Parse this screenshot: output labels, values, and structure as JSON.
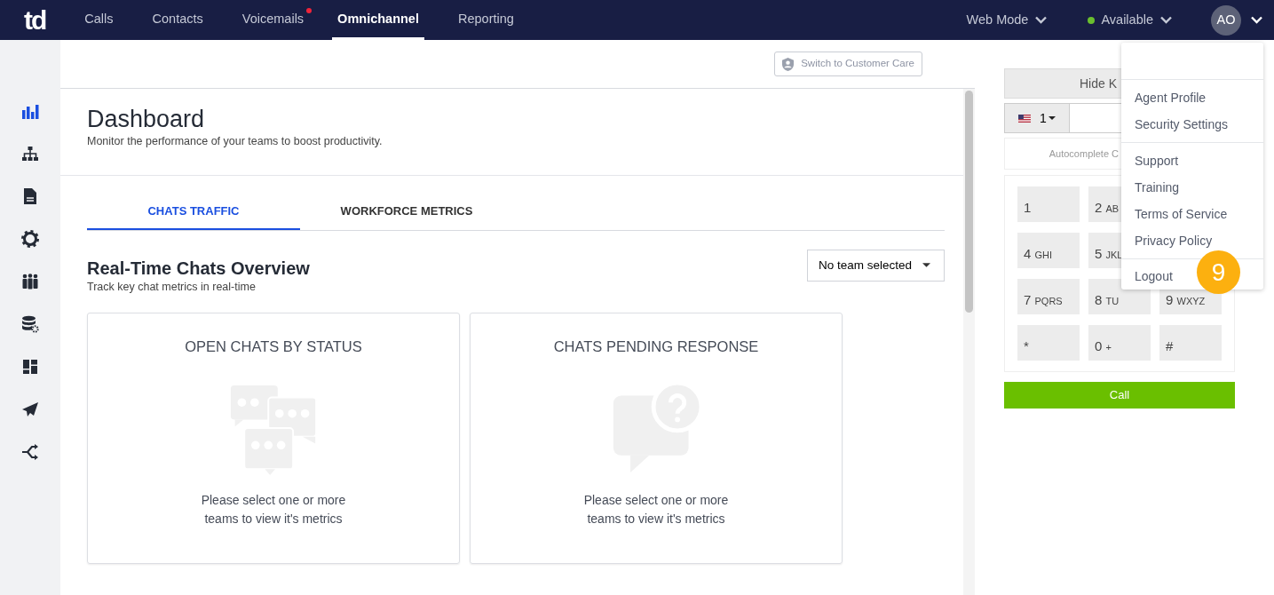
{
  "navbar": {
    "logo": "td",
    "items": [
      {
        "label": "Calls",
        "selected": false,
        "notification": false
      },
      {
        "label": "Contacts",
        "selected": false,
        "notification": false
      },
      {
        "label": "Voicemails",
        "selected": false,
        "notification": true
      },
      {
        "label": "Omnichannel",
        "selected": true,
        "notification": false
      },
      {
        "label": "Reporting",
        "selected": false,
        "notification": false
      }
    ],
    "mode": "Web Mode",
    "status": {
      "label": "Available",
      "color": "#6abf2e"
    },
    "avatar": "AO"
  },
  "sidebar": {
    "items": [
      {
        "selected": true
      },
      {
        "selected": false
      },
      {
        "selected": false
      },
      {
        "selected": false
      },
      {
        "selected": false
      },
      {
        "selected": false
      },
      {
        "selected": false
      },
      {
        "selected": false
      },
      {
        "selected": false
      }
    ]
  },
  "switch_button": "Switch to Customer Care",
  "header": {
    "title": "Dashboard",
    "subtitle": "Monitor the performance of your teams to boost productivity."
  },
  "tabs": [
    {
      "label": "CHATS TRAFFIC",
      "selected": true
    },
    {
      "label": "WORKFORCE METRICS",
      "selected": false
    }
  ],
  "section": {
    "title": "Real-Time Chats Overview",
    "subtitle": "Track key chat metrics in real-time",
    "team_select": "No team selected"
  },
  "cards": [
    {
      "title": "OPEN CHATS BY STATUS",
      "kind": "chats",
      "message": "Please select one or more teams to view it's metrics"
    },
    {
      "title": "CHATS PENDING RESPONSE",
      "kind": "pending",
      "message": "Please select one or more teams to view it's metrics"
    }
  ],
  "dialer": {
    "hide_button": "Hide K",
    "country_code": "1",
    "autocomplete": "Autocomplete C",
    "keys": [
      {
        "kind": "key",
        "digit": "1"
      },
      {
        "kind": "key",
        "digit": "2",
        "letters": "AB"
      },
      {
        "kind": "covered"
      },
      {
        "kind": "key",
        "digit": "4",
        "letters": "GHI"
      },
      {
        "kind": "key",
        "digit": "5",
        "letters": "JKL"
      },
      {
        "kind": "covered"
      },
      {
        "kind": "key",
        "digit": "7",
        "letters": "PQRS"
      },
      {
        "kind": "key",
        "digit": "8",
        "letters": "TU"
      },
      {
        "kind": "key",
        "digit": "9",
        "letters": "WXYZ"
      },
      {
        "kind": "key",
        "digit": "*"
      },
      {
        "kind": "key",
        "digit": "0",
        "letters": "+"
      },
      {
        "kind": "key",
        "digit": "#"
      }
    ],
    "call_button": "Call"
  },
  "user_menu": {
    "groups": [
      [
        "Agent Profile",
        "Security Settings"
      ],
      [
        "Support",
        "Training",
        "Terms of Service",
        "Privacy Policy"
      ],
      [
        "Logout"
      ]
    ]
  },
  "step_badge": "9"
}
